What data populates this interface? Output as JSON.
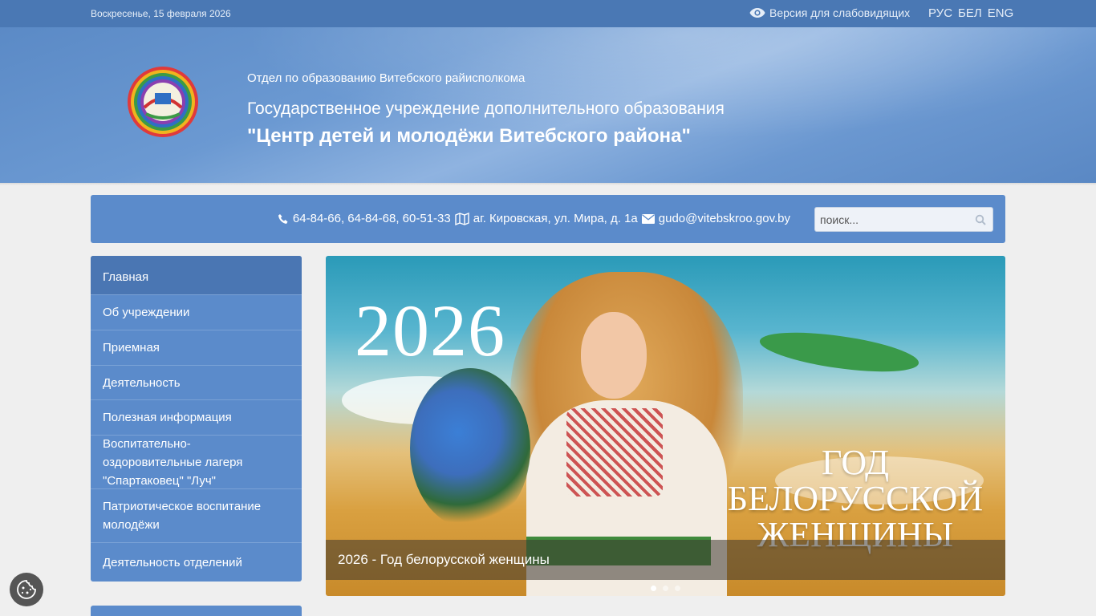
{
  "topbar": {
    "date": "Воскресенье, 15 февраля 2026",
    "low_vision": "Версия для слабовидящих",
    "langs": [
      "РУС",
      "БЕЛ",
      "ENG"
    ]
  },
  "header": {
    "department": "Отдел по образованию Витебского райисполкома",
    "institution": "Государственное учреждение дополнительного образования",
    "name": "\"Центр детей и молодёжи Витебского района\""
  },
  "contacts": {
    "phones": "64-84-66, 64-84-68, 60-51-33",
    "address": "аг. Кировская, ул. Мира, д. 1а",
    "email": "gudo@vitebskroo.gov.by"
  },
  "search": {
    "placeholder": "поиск..."
  },
  "sidebar": {
    "items": [
      {
        "label": "Главная"
      },
      {
        "label": "Об учреждении"
      },
      {
        "label": "Приемная"
      },
      {
        "label": "Деятельность"
      },
      {
        "label": "Полезная информация"
      },
      {
        "label": "Воспитательно-оздоровительные лагеря \"Спартаковец\" \"Луч\""
      },
      {
        "label": "Патриотическое воспитание молодёжи"
      },
      {
        "label": "Деятельность отделений"
      }
    ]
  },
  "banner": {
    "year": "2026",
    "slogan_line1": "ГОД",
    "slogan_line2": "БЕЛОРУССКОЙ",
    "slogan_line3": "ЖЕНЩИНЫ",
    "caption": "2026 - Год белорусской женщины"
  },
  "colors": {
    "topbar": "#4a78b4",
    "panel": "#5b8bcb",
    "active": "#4a76b3"
  }
}
